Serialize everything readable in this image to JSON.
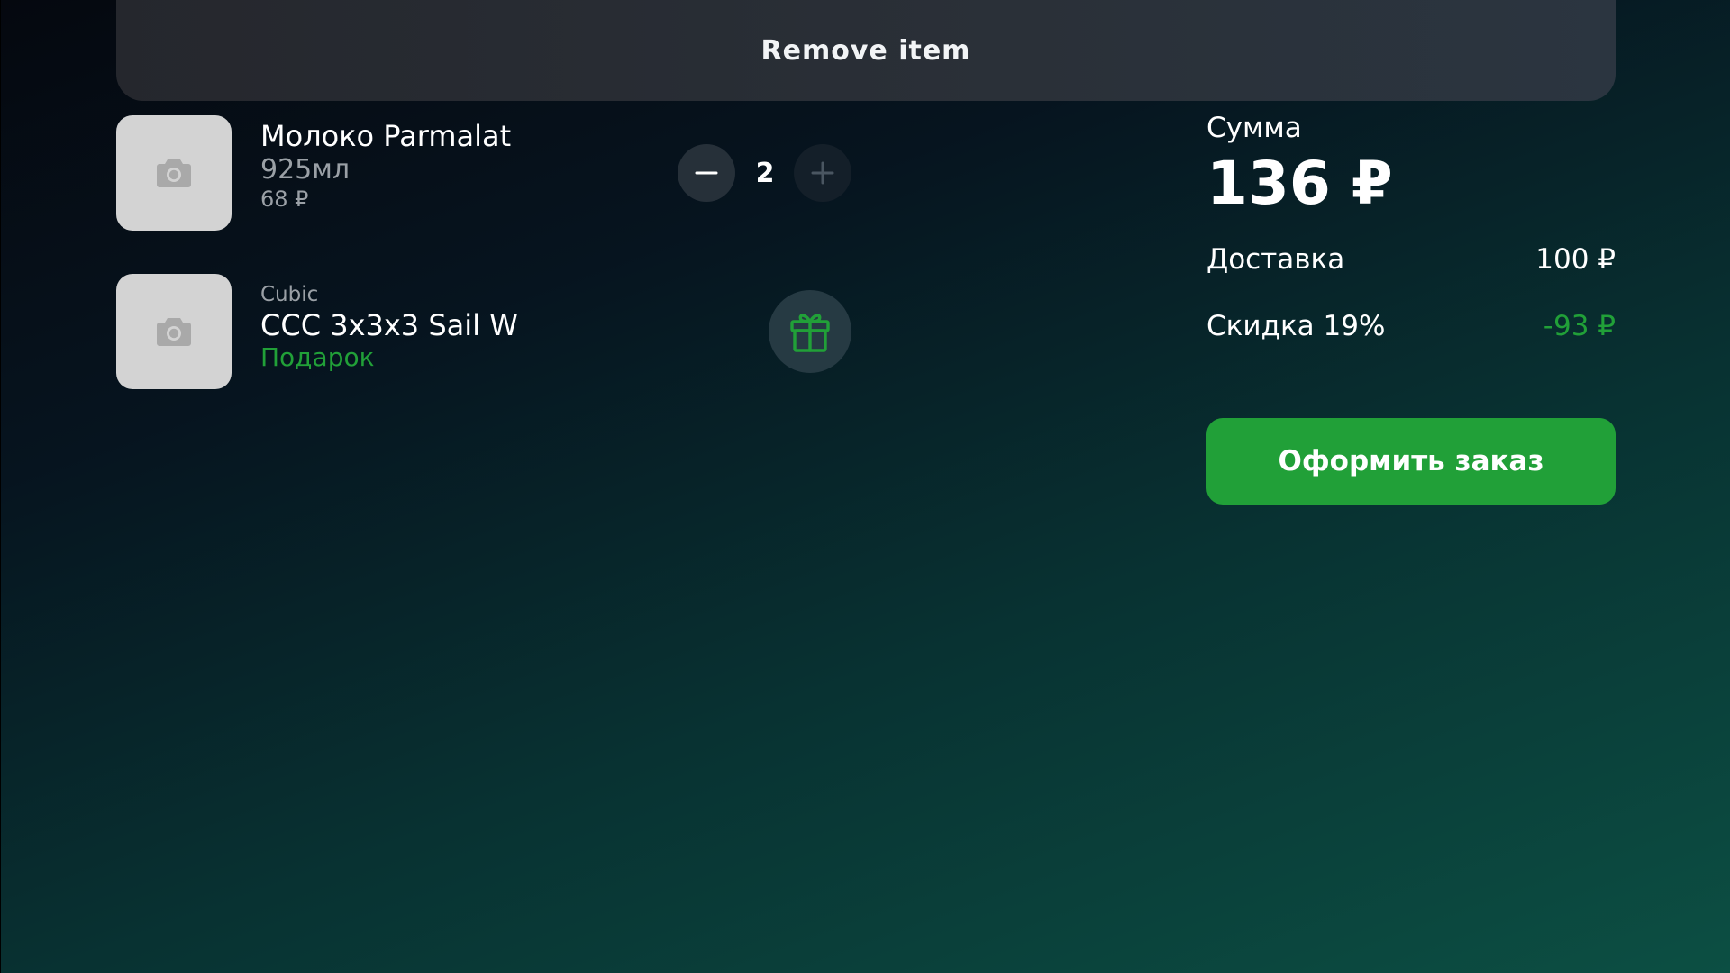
{
  "header": {
    "remove_label": "Remove item"
  },
  "cart": {
    "items": [
      {
        "name": "Молоко Parmalat",
        "volume": "925мл",
        "price": "68 ₽",
        "quantity": "2"
      },
      {
        "brand": "Cubic",
        "name": "CCC 3x3x3 Sail W",
        "tag": "Подарок"
      }
    ]
  },
  "summary": {
    "sum_label": "Сумма",
    "total": "136 ₽",
    "delivery_label": "Доставка",
    "delivery_value": "100 ₽",
    "discount_label": "Скидка 19%",
    "discount_value": "-93 ₽",
    "checkout_label": "Оформить заказ"
  },
  "icons": {
    "thumbnail": "camera-icon",
    "decrease": "minus-icon",
    "increase": "plus-icon",
    "gift": "gift-icon"
  },
  "colors": {
    "accent": "#21a038",
    "thumbnail_bg": "#d3d3d3",
    "muted_text": "#9aa0a6"
  }
}
